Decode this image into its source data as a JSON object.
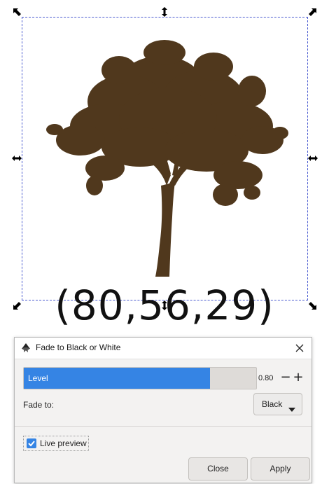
{
  "canvas": {
    "color_label": "(80,56,29)",
    "tree_color": "#50381d",
    "selection_color": "#4a5bd0"
  },
  "dialog": {
    "title": "Fade to Black or White",
    "app_icon": "inkscape-icon",
    "close_icon": "close-icon",
    "level": {
      "label": "Level",
      "value_text": "0.80",
      "value": 0.8,
      "minus": "−",
      "plus": "+",
      "fill_color": "#3584e4"
    },
    "fade_to": {
      "label": "Fade to:",
      "selected": "Black"
    },
    "live_preview": {
      "label": "Live preview",
      "checked": true
    },
    "buttons": {
      "close": "Close",
      "apply": "Apply"
    }
  }
}
